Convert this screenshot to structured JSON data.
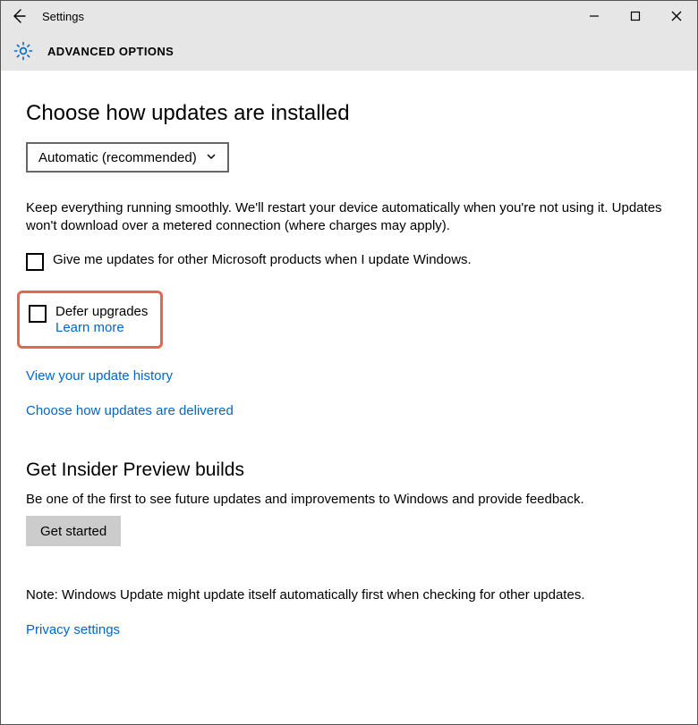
{
  "titlebar": {
    "title": "Settings"
  },
  "subheader": {
    "label": "ADVANCED OPTIONS"
  },
  "section1": {
    "heading": "Choose how updates are installed",
    "dropdown_value": "Automatic (recommended)",
    "description": "Keep everything running smoothly. We'll restart your device automatically when you're not using it. Updates won't download over a metered connection (where charges may apply).",
    "chk_other_products": "Give me updates for other Microsoft products when I update Windows.",
    "defer_label": "Defer upgrades",
    "defer_learn": "Learn more",
    "link_history": "View your update history",
    "link_delivered": "Choose how updates are delivered"
  },
  "section2": {
    "heading": "Get Insider Preview builds",
    "description": "Be one of the first to see future updates and improvements to Windows and provide feedback.",
    "button": "Get started",
    "note": "Note: Windows Update might update itself automatically first when checking for other updates.",
    "privacy": "Privacy settings"
  }
}
